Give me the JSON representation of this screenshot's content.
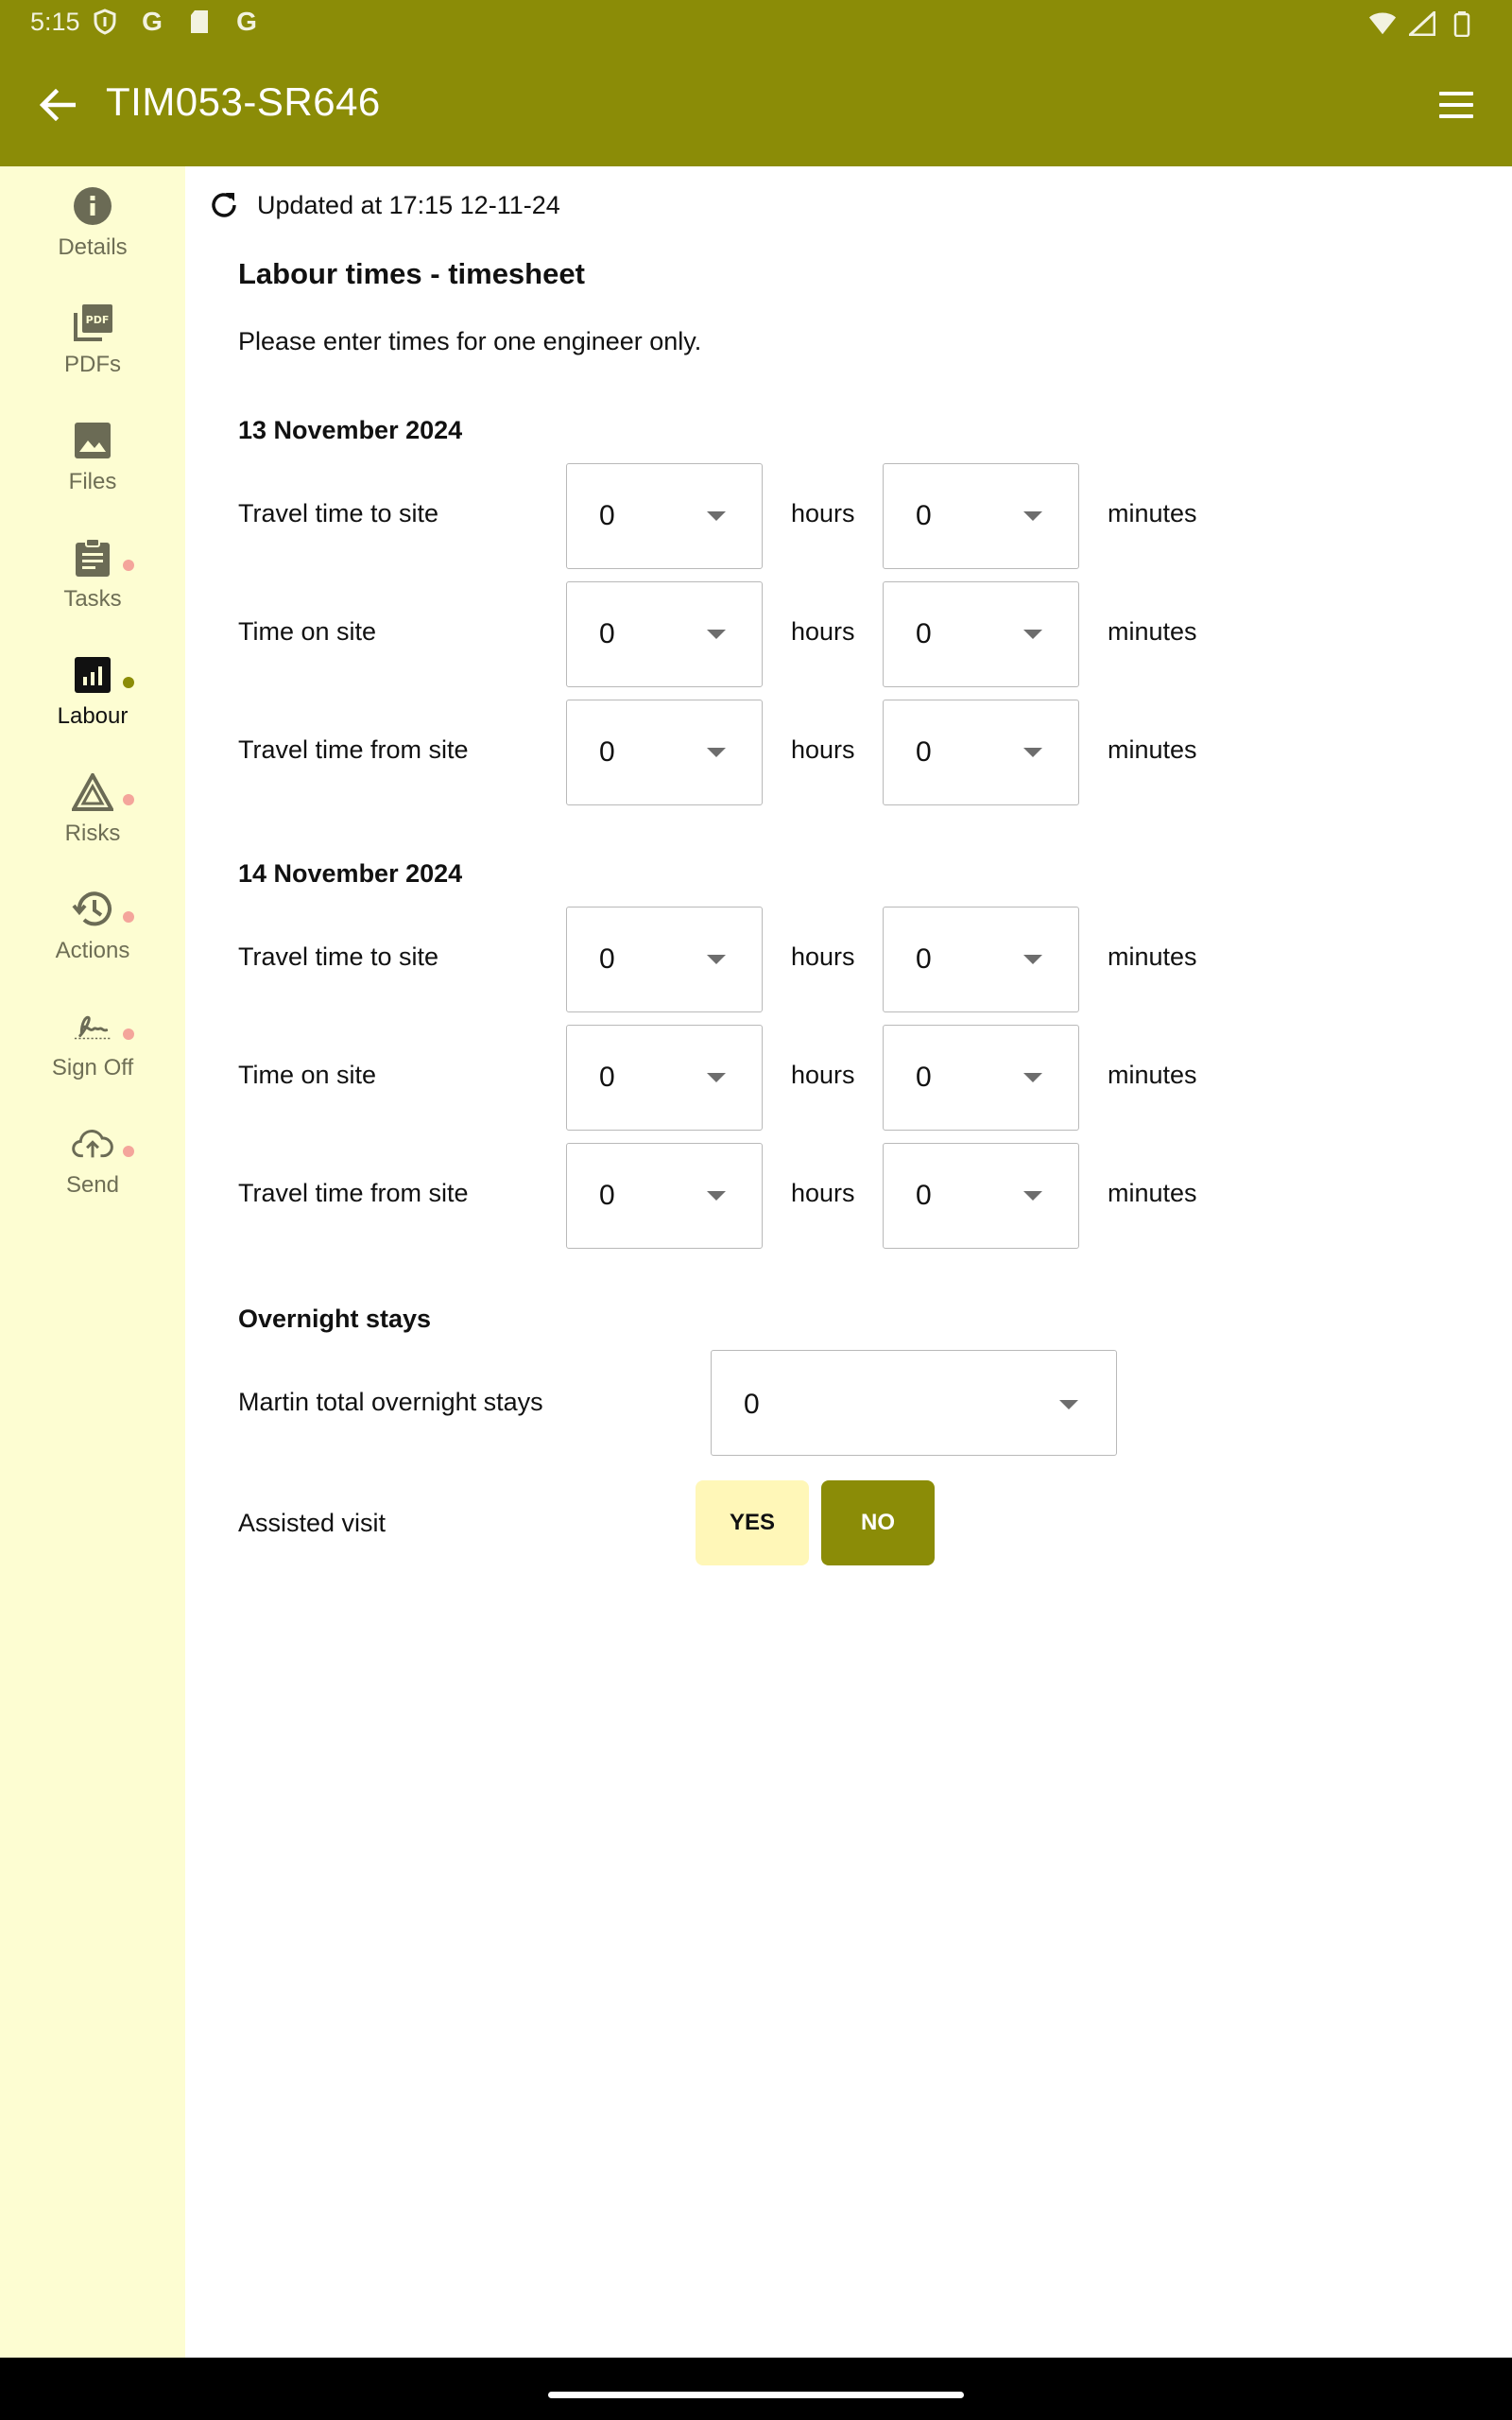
{
  "status_bar": {
    "time": "5:15"
  },
  "app_bar": {
    "title": "TIM053-SR646"
  },
  "sidebar": {
    "items": [
      {
        "label": "Details",
        "icon": "info-icon",
        "dot": false,
        "active": false
      },
      {
        "label": "PDFs",
        "icon": "pdf-icon",
        "dot": false,
        "active": false
      },
      {
        "label": "Files",
        "icon": "image-icon",
        "dot": false,
        "active": false
      },
      {
        "label": "Tasks",
        "icon": "clipboard-icon",
        "dot": true,
        "active": false
      },
      {
        "label": "Labour",
        "icon": "chart-icon",
        "dot": true,
        "active": true
      },
      {
        "label": "Risks",
        "icon": "warning-icon",
        "dot": true,
        "active": false
      },
      {
        "label": "Actions",
        "icon": "history-icon",
        "dot": true,
        "active": false
      },
      {
        "label": "Sign Off",
        "icon": "signature-icon",
        "dot": true,
        "active": false
      },
      {
        "label": "Send",
        "icon": "cloud-upload-icon",
        "dot": true,
        "active": false
      }
    ]
  },
  "content": {
    "updated": "Updated at 17:15 12-11-24",
    "title": "Labour times - timesheet",
    "intro": "Please enter times for one engineer only.",
    "days": [
      {
        "date": "13 November 2024",
        "rows": [
          {
            "label": "Travel time to site",
            "hours": "0",
            "minutes": "0"
          },
          {
            "label": "Time on site",
            "hours": "0",
            "minutes": "0"
          },
          {
            "label": "Travel time from site",
            "hours": "0",
            "minutes": "0"
          }
        ]
      },
      {
        "date": "14 November 2024",
        "rows": [
          {
            "label": "Travel time to site",
            "hours": "0",
            "minutes": "0"
          },
          {
            "label": "Time on site",
            "hours": "0",
            "minutes": "0"
          },
          {
            "label": "Travel time from site",
            "hours": "0",
            "minutes": "0"
          }
        ]
      }
    ],
    "unit_hours": "hours",
    "unit_minutes": "minutes",
    "overnight": {
      "heading": "Overnight stays",
      "label": "Martin total overnight stays",
      "value": "0"
    },
    "assisted": {
      "label": "Assisted visit",
      "yes": "YES",
      "no": "NO",
      "selected": "NO"
    }
  },
  "colors": {
    "primary": "#8b8c07",
    "sidebar_bg": "#fdfdd2",
    "dot_pending": "#f4a59b",
    "yes_bg": "#fff7b8"
  }
}
